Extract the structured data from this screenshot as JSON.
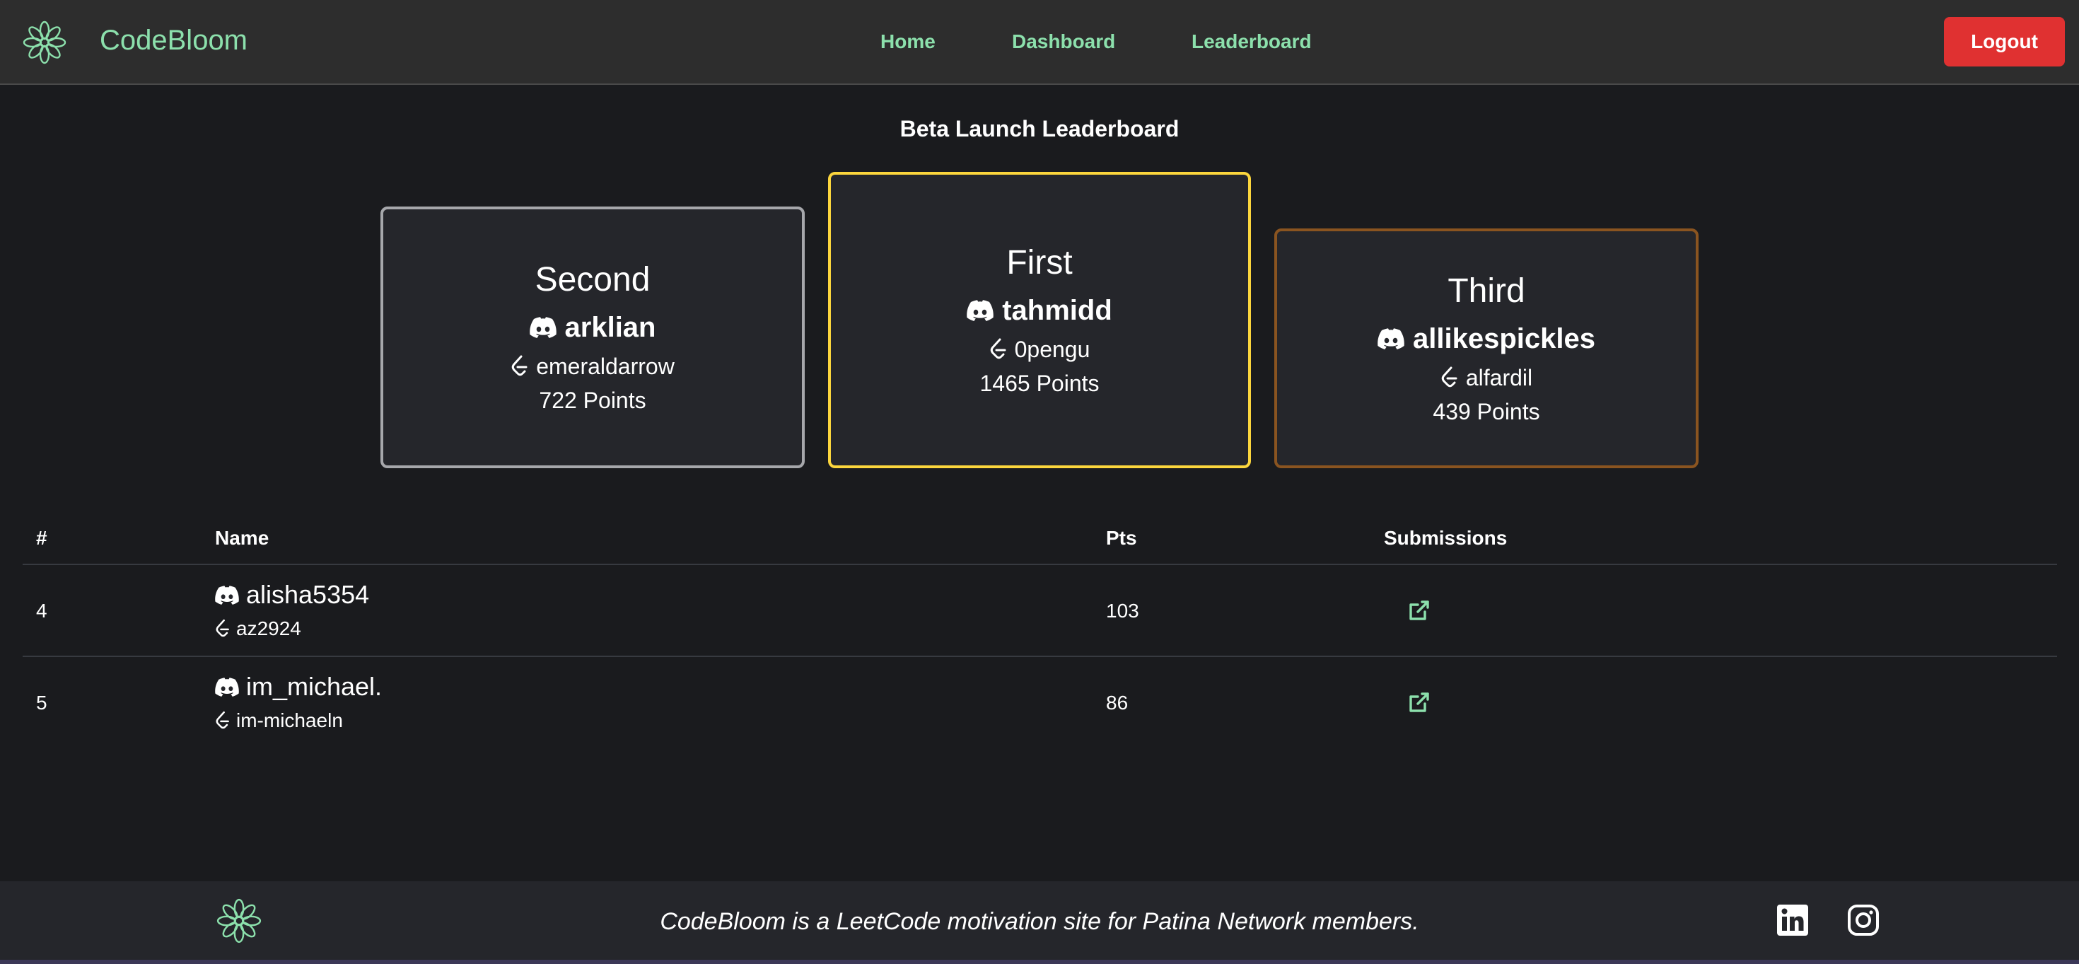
{
  "header": {
    "brand": "CodeBloom",
    "logo_icon": "flower-icon",
    "nav": [
      "Home",
      "Dashboard",
      "Leaderboard"
    ],
    "logout_label": "Logout",
    "accent": "#8ce0ac",
    "logout_color": "#e03131"
  },
  "page_title": "Beta Launch Leaderboard",
  "podium": {
    "first": {
      "place": "First",
      "discord": "tahmidd",
      "leetcode": "0pengu",
      "points": "1465 Points",
      "border": "#fcd63d"
    },
    "second": {
      "place": "Second",
      "discord": "arklian",
      "leetcode": "emeraldarrow",
      "points": "722 Points",
      "border": "#a6a7ab"
    },
    "third": {
      "place": "Third",
      "discord": "allikespickles",
      "leetcode": "alfardil",
      "points": "439 Points",
      "border": "#8a5420"
    }
  },
  "table": {
    "headers": {
      "rank": "#",
      "name": "Name",
      "pts": "Pts",
      "submissions": "Submissions"
    },
    "rows": [
      {
        "rank": "4",
        "discord": "alisha5354",
        "leetcode": "az2924",
        "pts": "103",
        "submissions_icon": "external-link-icon"
      },
      {
        "rank": "5",
        "discord": "im_michael.",
        "leetcode": "im-michaeln",
        "pts": "86",
        "submissions_icon": "external-link-icon"
      }
    ]
  },
  "footer": {
    "text": "CodeBloom is a LeetCode motivation site for Patina Network members.",
    "icons": [
      "flower-icon",
      "linkedin-icon",
      "instagram-icon"
    ]
  }
}
